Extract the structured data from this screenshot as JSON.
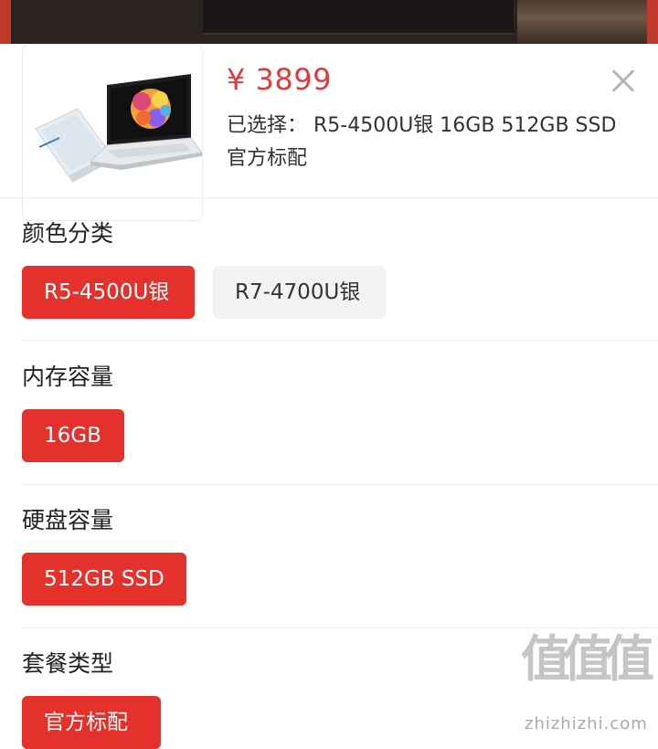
{
  "product": {
    "price": "¥ 3899",
    "selected_text": "已选择： R5-4500U银 16GB 512GB SSD 官方标配",
    "close_icon": "close-icon",
    "image_icon": "laptop-image"
  },
  "sections": {
    "color": {
      "title": "颜色分类",
      "options": [
        "R5-4500U银",
        "R7-4700U银"
      ],
      "selected": "R5-4500U银"
    },
    "memory": {
      "title": "内存容量",
      "options": [
        "16GB"
      ],
      "selected": "16GB"
    },
    "storage": {
      "title": "硬盘容量",
      "options": [
        "512GB SSD"
      ],
      "selected": "512GB SSD"
    },
    "package": {
      "title": "套餐类型",
      "options": [
        "官方标配"
      ],
      "selected": "官方标配"
    }
  },
  "watermark": {
    "glyphs": [
      "值",
      "值",
      "值"
    ],
    "site": "zhizhizhi.com"
  },
  "colors": {
    "accent": "#e4312b",
    "price": "#e4393c",
    "inactive_bg": "#f2f2f2"
  }
}
